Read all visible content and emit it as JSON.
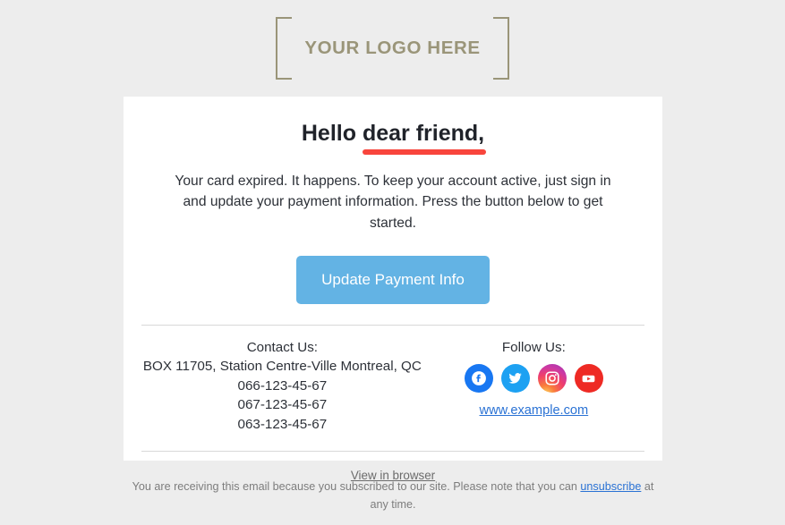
{
  "colors": {
    "page_background": "#ededed",
    "card_background": "#ffffff",
    "logo": "#9a9579",
    "headline": "#20232a",
    "headline_underline": "#f8453c",
    "cta_background": "#63b3e4",
    "cta_text": "#ffffff",
    "link_blue": "#2a72d4",
    "muted_text": "#7d7d7d",
    "facebook": "#1877f2",
    "twitter": "#1da1f2",
    "youtube": "#ee2a24"
  },
  "logo": {
    "text": "YOUR LOGO HERE"
  },
  "hero": {
    "headline_prefix": "Hello ",
    "headline_highlight": "dear friend,",
    "body": "Your card expired. It happens. To keep your account active, just sign in and update your payment information. Press the button below to get started.",
    "cta_label": "Update Payment Info"
  },
  "footer": {
    "contact": {
      "heading": "Contact Us:",
      "lines": [
        "BOX 11705, Station Centre-Ville Montreal, QC",
        "066-123-45-67",
        "067-123-45-67",
        "063-123-45-67"
      ]
    },
    "follow": {
      "heading": "Follow Us:",
      "socials": [
        {
          "name": "facebook-icon",
          "label": "Facebook"
        },
        {
          "name": "twitter-icon",
          "label": "Twitter"
        },
        {
          "name": "instagram-icon",
          "label": "Instagram"
        },
        {
          "name": "youtube-icon",
          "label": "YouTube"
        }
      ],
      "website": "www.example.com"
    },
    "view_in_browser": "View in browser"
  },
  "disclaimer": {
    "text_before": "You are receiving this email because you subscribed to our site. Please note that you can ",
    "link": "unsubscribe",
    "text_after": " at any time."
  }
}
